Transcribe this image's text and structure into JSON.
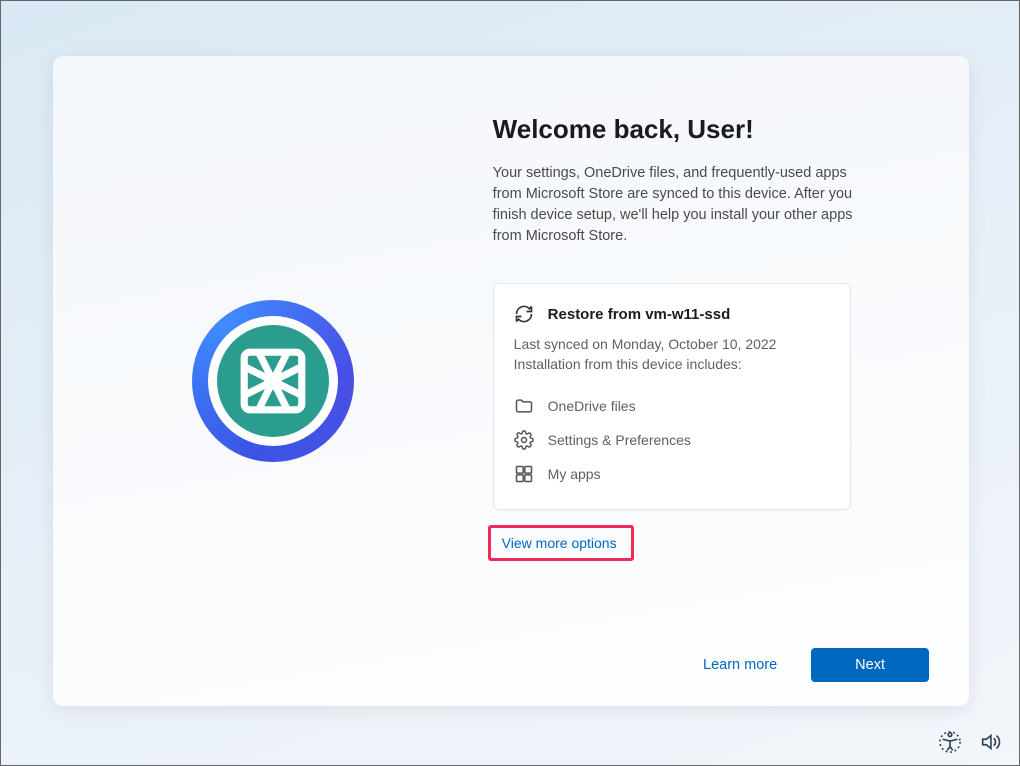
{
  "title": "Welcome back, User!",
  "description": "Your settings, OneDrive files, and frequently-used apps from Microsoft Store are synced to this device. After you finish device setup, we'll help you install your other apps from Microsoft Store.",
  "restore": {
    "title": "Restore from vm-w11-ssd",
    "last_synced": "Last synced on Monday, October 10, 2022",
    "includes_label": "Installation from this device includes:",
    "items": [
      {
        "icon": "folder",
        "label": "OneDrive files"
      },
      {
        "icon": "gear",
        "label": "Settings & Preferences"
      },
      {
        "icon": "apps",
        "label": "My apps"
      }
    ]
  },
  "more_options_label": "View more options",
  "footer": {
    "learn_more": "Learn more",
    "next": "Next"
  }
}
